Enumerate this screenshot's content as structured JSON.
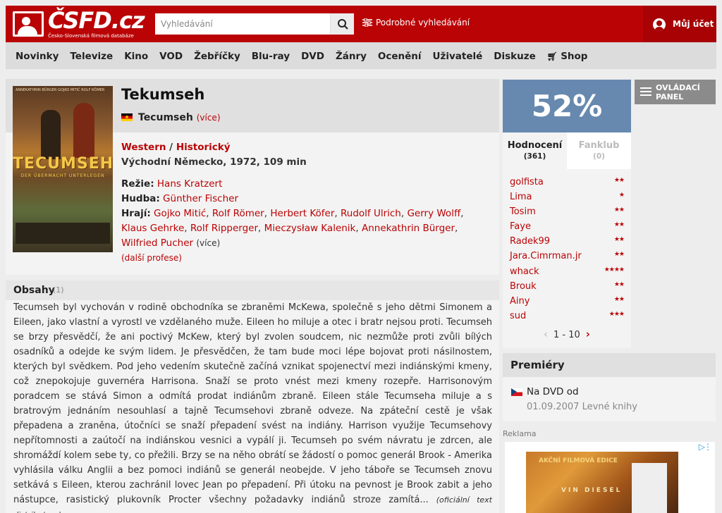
{
  "header": {
    "logo_text": "ČSFD.cz",
    "logo_tagline": "Česko-Slovenská filmová databáze",
    "search_placeholder": "Vyhledávání",
    "advanced_search": "Podrobné vyhledávání",
    "account": "Můj účet"
  },
  "nav": [
    "Novinky",
    "Televize",
    "Kino",
    "VOD",
    "Žebříčky",
    "Blu-ray",
    "DVD",
    "Žánry",
    "Ocenění",
    "Uživatelé",
    "Diskuze",
    "Shop"
  ],
  "film": {
    "title": "Tekumseh",
    "original_title": "Tecumseh",
    "more": "(více)",
    "genre1": "Western",
    "genre_sep": " / ",
    "genre2": "Historický",
    "origin": "Východní Německo, 1972, 109 min",
    "director_label": "Režie:",
    "director": "Hans Kratzert",
    "music_label": "Hudba:",
    "music": "Günther Fischer",
    "cast_label": "Hrají:",
    "cast": [
      "Gojko Mitić",
      "Rolf Römer",
      "Herbert Köfer",
      "Rudolf Ulrich",
      "Gerry Wolff",
      "Klaus Gehrke",
      "Rolf Ripperger",
      "Mieczysław Kalenik",
      "Annekathrin Bürger",
      "Wilfried Pucher"
    ],
    "cast_more": "(více)",
    "more_professions": "(další profese)",
    "poster": {
      "cast_line": "ANNEKATHRIN BÜRGER  GOJKO MITIĆ  ROLF RÖMER",
      "title": "TECUMSEH",
      "subtitle": "DER ÜBERMACHT UNTERLEGEN"
    }
  },
  "plot": {
    "title": "Obsahy",
    "count": "(1)",
    "text": "Tecumseh byl vychován v rodině obchodníka se zbraněmi McKewa, společně s jeho dětmi Simonem a Eileen, jako vlastní a vyrostl ve vzdělaného muže. Eileen ho miluje a otec i bratr nejsou proti. Tecumseh se brzy přesvědčí, že ani poctivý McKew, který byl zvolen soudcem, nic nezmůže proti zvůli bílých osadníků a odejde ke svým lidem. Je přesvědčen, že tam bude moci lépe bojovat proti násilnostem, kterých byl svědkem. Pod jeho vedením skutečně začíná vznikat spojenectví mezi indiánskými kmeny, což znepokojuje guvernéra Harrisona. Snaží se proto vnést mezi kmeny rozepře. Harrisonovým poradcem se stává Simon a odmítá prodat indiánům zbraně. Eileen stále Tecumseha miluje a s bratrovým jednáním nesouhlasí a tajně Tecumsehovi zbraně odveze. Na zpáteční cestě je však přepadena a zraněna, útočníci se snaží přepadení svést na indiány. Harrison využije Tecumsehovy nepřítomnosti a zaútočí na indiánskou vesnici a vypálí ji. Tecumseh po svém návratu je zdrcen, ale shromáždí kolem sebe ty, co přežili. Brzy se na něho obrátí se žádostí o pomoc generál Brook - Amerika vyhlásila válku Anglii a bez pomoci indiánů se generál neobejde. V jeho táboře se Tecumseh znovu setkává s Eileen, kterou zachránil lovec Jean po přepadení. Při útoku na pevnost je Brook zabit a jeho nástupce, rasistický plukovník Procter všechny požadavky indiánů stroze zamítá...",
    "source": "(oficiální text distributora)"
  },
  "rating": {
    "percent": "52%",
    "tab1": "Hodnocení",
    "tab1_count": "(361)",
    "tab2": "Fanklub",
    "tab2_count": "(0)",
    "users": [
      {
        "name": "golfista",
        "stars": "★★"
      },
      {
        "name": "Lima",
        "stars": "★"
      },
      {
        "name": "Tosim",
        "stars": "★★"
      },
      {
        "name": "Faye",
        "stars": "★★"
      },
      {
        "name": "Radek99",
        "stars": "★★"
      },
      {
        "name": "Jara.Cimrman.jr",
        "stars": "★★"
      },
      {
        "name": "whack",
        "stars": "★★★★"
      },
      {
        "name": "Brouk",
        "stars": "★★"
      },
      {
        "name": "Ainy",
        "stars": "★★"
      },
      {
        "name": "sud",
        "stars": "★★★"
      }
    ],
    "pager": "1 - 10"
  },
  "control_panel": "OVLÁDACÍ PANEL",
  "premieres": {
    "title": "Premiéry",
    "label": "Na DVD od",
    "date": "01.09.2007 Levné knihy"
  },
  "ad": {
    "label": "Reklama",
    "top_text": "AKČNÍ FILMOVÁ EDICE",
    "name": "VIN DIESEL"
  },
  "colors": {
    "brand": "#ba0305",
    "rating_bg": "#6789af"
  }
}
